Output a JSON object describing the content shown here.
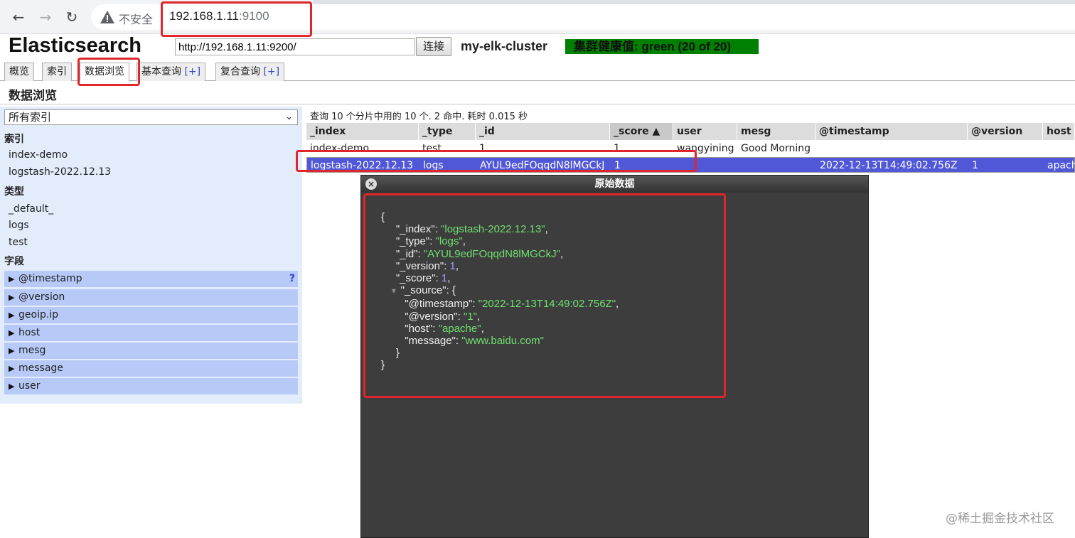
{
  "browser": {
    "back_icon": "arrow-left-icon",
    "forward_icon": "arrow-right-icon",
    "reload_icon": "reload-icon",
    "security_label": "不安全",
    "url_host": "192.168.1.11",
    "url_port": ":9100"
  },
  "header": {
    "title": "Elasticsearch",
    "connect_url": "http://192.168.1.11:9200/",
    "connect_button": "连接",
    "cluster_name": "my-elk-cluster",
    "health": "集群健康值: green (20 of 20)",
    "health_color": "#008000"
  },
  "tabs": [
    {
      "label": "概览",
      "plus": ""
    },
    {
      "label": "索引",
      "plus": ""
    },
    {
      "label": "数据浏览",
      "plus": ""
    },
    {
      "label": "基本查询",
      "plus": "[+]"
    },
    {
      "label": "复合查询",
      "plus": "[+]"
    }
  ],
  "section_title": "数据浏览",
  "sidebar": {
    "index_select": "所有索引",
    "index_header": "索引",
    "indices": [
      "index-demo",
      "logstash-2022.12.13"
    ],
    "type_header": "类型",
    "types": [
      "_default_",
      "logs",
      "test"
    ],
    "field_header": "字段",
    "fields": [
      "@timestamp",
      "@version",
      "geoip.ip",
      "host",
      "mesg",
      "message",
      "user"
    ],
    "help_mark": "?"
  },
  "results": {
    "info": "查询 10 个分片中用的 10 个. 2 命中. 耗时 0.015 秒",
    "columns": [
      "_index",
      "_type",
      "_id",
      "_score ▲",
      "user",
      "mesg",
      "@timestamp",
      "@version",
      "host"
    ],
    "rows": [
      [
        "index-demo",
        "test",
        "1",
        "1",
        "wangyining",
        "Good Morning",
        "",
        "",
        ""
      ],
      [
        "logstash-2022.12.13",
        "logs",
        "AYUL9edFOqqdN8lMGCkJ",
        "1",
        "",
        "",
        "2022-12-13T14:49:02.756Z",
        "1",
        "apache"
      ]
    ],
    "selected_row_color": "#5058d8"
  },
  "dialog": {
    "title": "原始数据",
    "close_icon": "close-icon",
    "open_brace": "{",
    "index_key": "\"_index\": ",
    "index_val": "\"logstash-2022.12.13\"",
    "type_key": "\"_type\": ",
    "type_val": "\"logs\"",
    "id_key": "\"_id\": ",
    "id_val": "\"AYUL9edFOqqdN8lMGCkJ\"",
    "version_key": "\"_version\": ",
    "version_val": "1",
    "score_key": "\"_score\": ",
    "score_val": "1",
    "source_key": "\"_source\": {",
    "ts_key": "\"@timestamp\": ",
    "ts_val": "\"2022-12-13T14:49:02.756Z\"",
    "ver_key": "\"@version\": ",
    "ver_val": "\"1\"",
    "host_key": "\"host\": ",
    "host_val": "\"apache\"",
    "msg_key": "\"message\": ",
    "msg_val": "\"www.baidu.com\"",
    "close_inner": "}",
    "close_outer": "}"
  },
  "watermark": "@稀土掘金技术社区"
}
